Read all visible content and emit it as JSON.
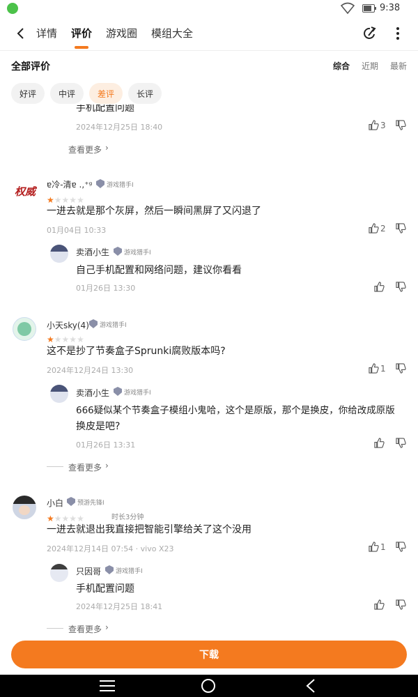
{
  "status_bar": {
    "time": "9:38",
    "icons": [
      "app-notification-icon",
      "wifi-icon",
      "battery-icon"
    ]
  },
  "header": {
    "tabs": [
      {
        "label": "详情"
      },
      {
        "label": "评价"
      },
      {
        "label": "游戏圈"
      },
      {
        "label": "模组大全"
      }
    ],
    "active_tab": "评价",
    "icons": [
      "back-arrow-icon",
      "share-icon",
      "more-vertical-icon"
    ]
  },
  "reviews_section": {
    "title": "全部评价",
    "sort_options": [
      "综合",
      "近期",
      "最新"
    ],
    "active_sort": "综合",
    "filters": [
      "好评",
      "中评",
      "差评",
      "长评"
    ],
    "active_filter": "差评"
  },
  "partial_top": {
    "reply_text": "手机配置问题",
    "reply_time": "2024年12月25日 18:40",
    "likes": "3",
    "see_more": "查看更多"
  },
  "reviews": [
    {
      "username": "ɐ冷-清ɐ .,⁺ᵍ",
      "badge": "游戏猎手Ⅰ",
      "rating": 1,
      "text": "一进去就是那个灰屏，然后一瞬间黑屏了又闪退了",
      "time": "01月04日 10:33",
      "likes": "2",
      "reply": {
        "username": "卖酒小生",
        "badge": "游戏猎手Ⅰ",
        "text": "自己手机配置和网络问题，建议你看看",
        "time": "01月26日 13:30"
      }
    },
    {
      "username": "小天sky(4)",
      "badge": "游戏猎手Ⅰ",
      "rating": 1,
      "text": "这不是抄了节奏盒子Sprunki腐败版本吗?",
      "time": "2024年12月24日 13:30",
      "likes": "1",
      "reply": {
        "username": "卖酒小生",
        "badge": "游戏猎手Ⅰ",
        "text_line1": "666疑似某个节奏盒子模组小鬼哈，这个是原版，那个是换皮，你给改成原版",
        "text_line2": "换皮是吧?",
        "time": "01月26日 13:31"
      },
      "see_more": "查看更多"
    },
    {
      "username": "小白",
      "badge": "预游先锋Ⅰ",
      "rating": 1,
      "playtime": "时长3分钟",
      "text": "一进去就退出我直接把智能引擎给关了这个没用",
      "time": "2024年12月14日 07:54 · vivo X23",
      "likes": "1",
      "reply": {
        "username": "只因哥",
        "badge": "游戏猎手Ⅰ",
        "text": "手机配置问题",
        "time": "2024年12月25日 18:41"
      },
      "see_more": "查看更多"
    }
  ],
  "download_button": "下载",
  "nav_bar": {
    "icons": [
      "menu-icon",
      "home-circle-icon",
      "back-triangle-icon"
    ]
  },
  "colors": {
    "accent": "#f47a1f",
    "chip_bg": "#f2f2f2",
    "chip_active_bg": "#fdeee1"
  }
}
